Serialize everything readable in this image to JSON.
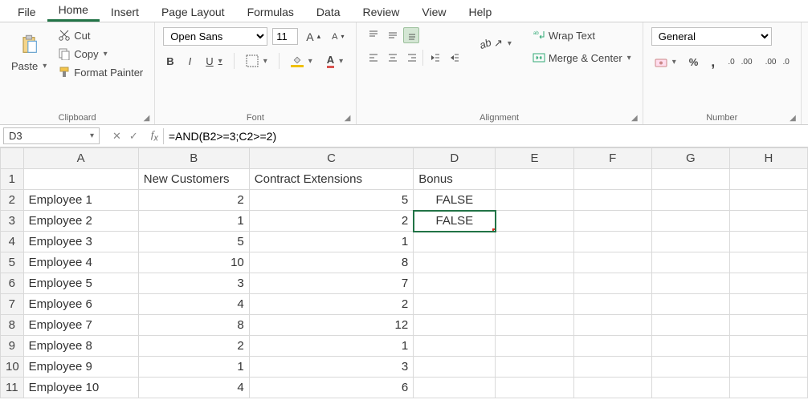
{
  "tabs": [
    "File",
    "Home",
    "Insert",
    "Page Layout",
    "Formulas",
    "Data",
    "Review",
    "View",
    "Help"
  ],
  "active_tab": "Home",
  "clipboard": {
    "paste": "Paste",
    "cut": "Cut",
    "copy": "Copy",
    "painter": "Format Painter",
    "title": "Clipboard"
  },
  "font": {
    "name": "Open Sans",
    "size": "11",
    "title": "Font"
  },
  "alignment": {
    "wrap": "Wrap Text",
    "merge": "Merge & Center",
    "title": "Alignment"
  },
  "number": {
    "format": "General",
    "title": "Number"
  },
  "namebox": "D3",
  "formula": "=AND(B2>=3;C2>=2)",
  "columns": [
    "A",
    "B",
    "C",
    "D",
    "E",
    "F",
    "G",
    "H"
  ],
  "headerRow": {
    "A": "",
    "B": "New Customers",
    "C": "Contract Extensions",
    "D": "Bonus"
  },
  "rows": [
    {
      "n": "2",
      "A": "Employee 1",
      "B": "2",
      "C": "5",
      "D": "FALSE"
    },
    {
      "n": "3",
      "A": "Employee 2",
      "B": "1",
      "C": "2",
      "D": "FALSE"
    },
    {
      "n": "4",
      "A": "Employee 3",
      "B": "5",
      "C": "1",
      "D": ""
    },
    {
      "n": "5",
      "A": "Employee 4",
      "B": "10",
      "C": "8",
      "D": ""
    },
    {
      "n": "6",
      "A": "Employee 5",
      "B": "3",
      "C": "7",
      "D": ""
    },
    {
      "n": "7",
      "A": "Employee 6",
      "B": "4",
      "C": "2",
      "D": ""
    },
    {
      "n": "8",
      "A": "Employee 7",
      "B": "8",
      "C": "12",
      "D": ""
    },
    {
      "n": "9",
      "A": "Employee 8",
      "B": "2",
      "C": "1",
      "D": ""
    },
    {
      "n": "10",
      "A": "Employee 9",
      "B": "1",
      "C": "3",
      "D": ""
    },
    {
      "n": "11",
      "A": "Employee 10",
      "B": "4",
      "C": "6",
      "D": ""
    }
  ],
  "selected": {
    "col": "D",
    "row": "3"
  }
}
